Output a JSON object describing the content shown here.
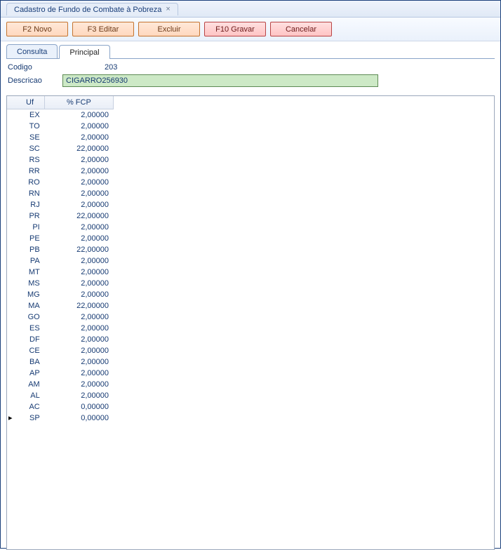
{
  "window": {
    "title": "Cadastro de Fundo de Combate à  Pobreza",
    "close_glyph": "×"
  },
  "toolbar": {
    "novo": "F2 Novo",
    "editar": "F3 Editar",
    "excluir": "Excluir",
    "gravar": "F10 Gravar",
    "cancelar": "Cancelar"
  },
  "tabs": {
    "consulta": "Consulta",
    "principal": "Principal"
  },
  "form": {
    "codigo_label": "Codigo",
    "codigo_value": "203",
    "descricao_label": "Descricao",
    "descricao_value": "CIGARRO256930"
  },
  "grid": {
    "headers": {
      "uf": "Uf",
      "fcp": "% FCP"
    },
    "rows": [
      {
        "uf": "EX",
        "fcp": "2,00000",
        "selected": false
      },
      {
        "uf": "TO",
        "fcp": "2,00000",
        "selected": false
      },
      {
        "uf": "SE",
        "fcp": "2,00000",
        "selected": false
      },
      {
        "uf": "SC",
        "fcp": "22,00000",
        "selected": false
      },
      {
        "uf": "RS",
        "fcp": "2,00000",
        "selected": false
      },
      {
        "uf": "RR",
        "fcp": "2,00000",
        "selected": false
      },
      {
        "uf": "RO",
        "fcp": "2,00000",
        "selected": false
      },
      {
        "uf": "RN",
        "fcp": "2,00000",
        "selected": false
      },
      {
        "uf": "RJ",
        "fcp": "2,00000",
        "selected": false
      },
      {
        "uf": "PR",
        "fcp": "22,00000",
        "selected": false
      },
      {
        "uf": "PI",
        "fcp": "2,00000",
        "selected": false
      },
      {
        "uf": "PE",
        "fcp": "2,00000",
        "selected": false
      },
      {
        "uf": "PB",
        "fcp": "22,00000",
        "selected": false
      },
      {
        "uf": "PA",
        "fcp": "2,00000",
        "selected": false
      },
      {
        "uf": "MT",
        "fcp": "2,00000",
        "selected": false
      },
      {
        "uf": "MS",
        "fcp": "2,00000",
        "selected": false
      },
      {
        "uf": "MG",
        "fcp": "2,00000",
        "selected": false
      },
      {
        "uf": "MA",
        "fcp": "22,00000",
        "selected": false
      },
      {
        "uf": "GO",
        "fcp": "2,00000",
        "selected": false
      },
      {
        "uf": "ES",
        "fcp": "2,00000",
        "selected": false
      },
      {
        "uf": "DF",
        "fcp": "2,00000",
        "selected": false
      },
      {
        "uf": "CE",
        "fcp": "2,00000",
        "selected": false
      },
      {
        "uf": "BA",
        "fcp": "2,00000",
        "selected": false
      },
      {
        "uf": "AP",
        "fcp": "2,00000",
        "selected": false
      },
      {
        "uf": "AM",
        "fcp": "2,00000",
        "selected": false
      },
      {
        "uf": "AL",
        "fcp": "2,00000",
        "selected": false
      },
      {
        "uf": "AC",
        "fcp": "0,00000",
        "selected": false
      },
      {
        "uf": "SP",
        "fcp": "0,00000",
        "selected": true
      }
    ]
  }
}
